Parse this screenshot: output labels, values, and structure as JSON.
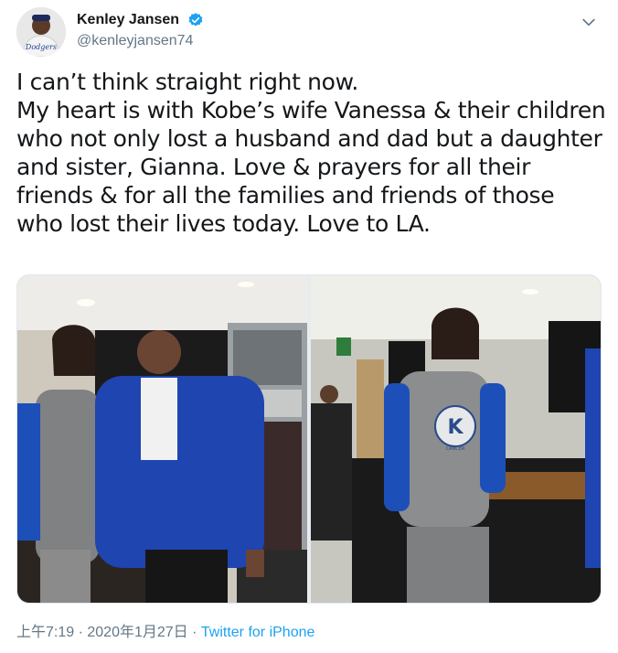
{
  "author": {
    "display_name": "Kenley Jansen",
    "handle": "@kenleyjansen74",
    "avatar_jersey_text": "Dodgers"
  },
  "tweet": {
    "text": "I can’t think straight right now.\nMy heart is with Kobe’s wife Vanessa & their children who not only lost a husband and dad but a daughter and sister, Gianna. Love & prayers for all their friends & for all the families and friends of those who lost their lives today. Love to LA."
  },
  "photos": {
    "shirt_logo_text": "CANCER",
    "shirt_logo_letter": "K"
  },
  "meta": {
    "time": "上午7:19",
    "separator1": " · ",
    "date": "2020年1月27日",
    "separator2": " · ",
    "source": "Twitter for iPhone"
  },
  "colors": {
    "link": "#1da1f2",
    "secondary": "#657786",
    "verified": "#1da1f2"
  },
  "icons": {
    "verified": "verified-badge-icon",
    "caret": "chevron-down-icon"
  }
}
